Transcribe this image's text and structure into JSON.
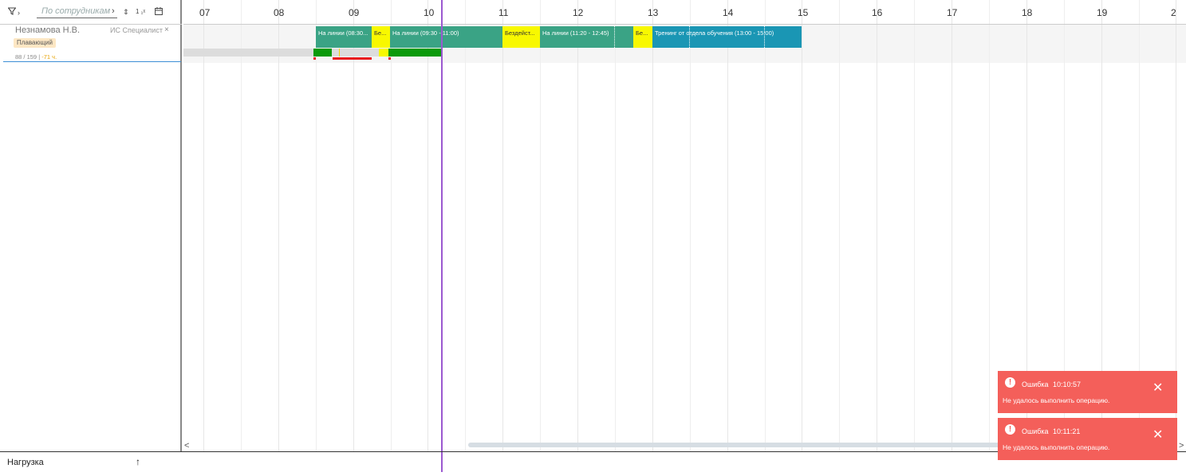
{
  "toolbar": {
    "filter_icon": "filter-icon",
    "expand_icon": "chevron-right",
    "search_placeholder": "По сотрудникам",
    "search_next_icon": "chevron-right",
    "sort_icon": "sort-icon",
    "clear_sort_icon": "clear-sort-icon",
    "calendar_icon": "calendar-icon"
  },
  "employee": {
    "name": "Незнамова Н.В.",
    "role": "ИС Специалист",
    "close": "×",
    "badge": "Плавающий",
    "stats_main": "88 / 159 | ",
    "stats_hl": "-71 ч."
  },
  "timeline": {
    "hours": [
      "07",
      "08",
      "09",
      "10",
      "11",
      "12",
      "13",
      "14",
      "15",
      "16",
      "17",
      "18",
      "19",
      "2"
    ],
    "segments": [
      {
        "label": "На линии (08:30...",
        "color": "teal"
      },
      {
        "label": "Бе...",
        "color": "yellow"
      },
      {
        "label": "На линии (09:30 - 11:00)",
        "color": "teal"
      },
      {
        "label": "Бездейст...",
        "color": "yellow"
      },
      {
        "label": "На линии (11:20 - 12:45)",
        "color": "teal"
      },
      {
        "label": "Бе...",
        "color": "yellow"
      },
      {
        "label": "Тренинг от отдела обучения (13:00 - 15:00)",
        "color": "blue"
      }
    ],
    "scroll_left": "<",
    "scroll_right": ">"
  },
  "bottom": {
    "load_label": "Нагрузка",
    "load_arrow": "↑"
  },
  "toasts": [
    {
      "title": "Ошибка",
      "time": "10:10:57",
      "message": "Не удалось выполнить операцию.",
      "close": "✕"
    },
    {
      "title": "Ошибка",
      "time": "10:11:21",
      "message": "Не удалось выполнить операцию.",
      "close": "✕"
    }
  ],
  "colors": {
    "teal": "#3aa385",
    "yellow": "#f8f800",
    "blue": "#1a96b4",
    "now_line": "#9b59d0",
    "toast_error": "#f45f5a"
  }
}
